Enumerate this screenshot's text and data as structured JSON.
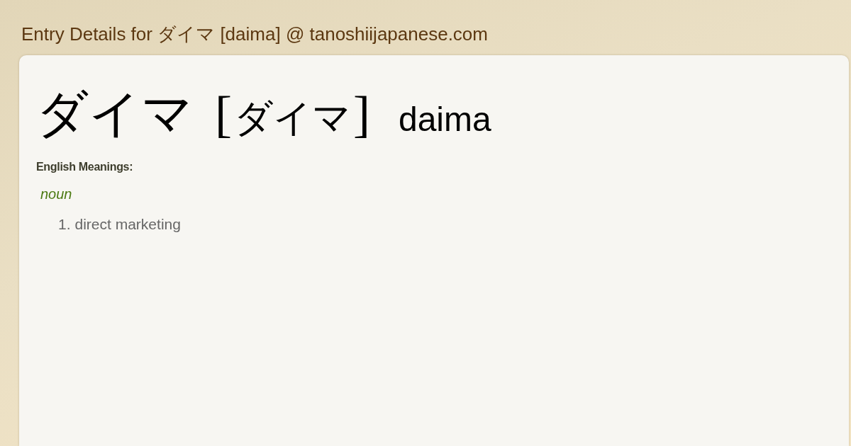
{
  "page_title": "Entry Details for ダイマ [daima] @ tanoshiijapanese.com",
  "entry": {
    "word": "ダイマ",
    "reading": {
      "open": "[",
      "text": "ダイマ",
      "close": "]"
    },
    "romaji": "daima"
  },
  "meanings_heading": "English Meanings:",
  "senses": [
    {
      "part_of_speech": "noun",
      "meanings": [
        {
          "number": "1.",
          "text": "direct marketing"
        }
      ]
    }
  ]
}
